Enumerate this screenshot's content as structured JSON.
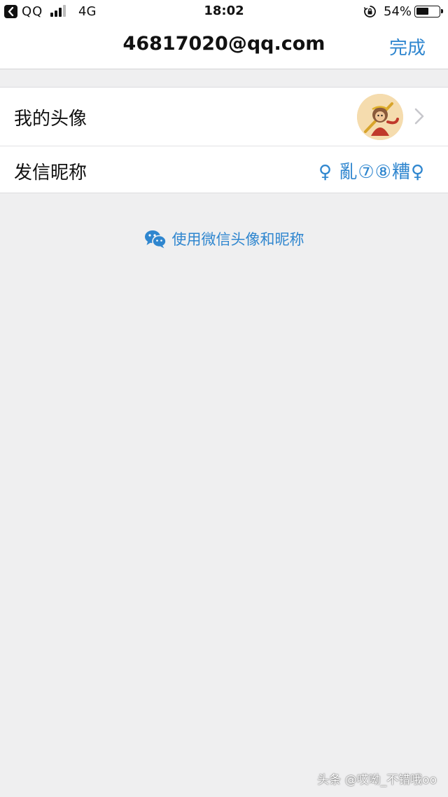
{
  "status_bar": {
    "back_app": "QQ",
    "network": "4G",
    "time": "18:02",
    "battery_percent": "54%",
    "battery_level": 0.54
  },
  "nav": {
    "title": "46817020@qq.com",
    "done_label": "完成"
  },
  "settings": {
    "avatar_label": "我的头像",
    "nickname_label": "发信昵称",
    "nickname_value": "♀ 亂⑦⑧糟♀"
  },
  "wechat": {
    "label": "使用微信头像和昵称",
    "icon": "wechat-icon"
  },
  "watermark": "头条 @哎呦_不错哦oo",
  "colors": {
    "accent": "#2f86cf",
    "background": "#efeff0",
    "surface": "#ffffff"
  }
}
